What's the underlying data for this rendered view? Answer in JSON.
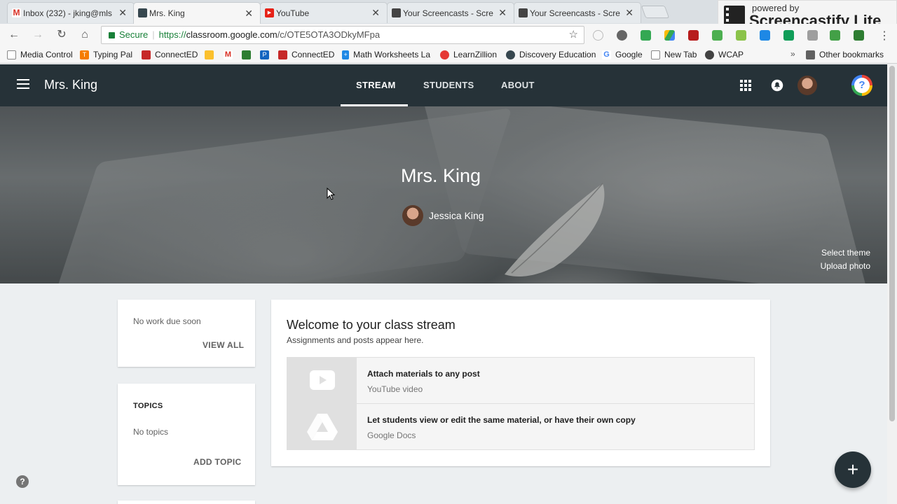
{
  "browser": {
    "tabs": [
      {
        "title": "Inbox (232) - jking@mls",
        "icon": "gmail-icon"
      },
      {
        "title": "Mrs. King",
        "icon": "classroom-icon"
      },
      {
        "title": "YouTube",
        "icon": "youtube-icon"
      },
      {
        "title": "Your Screencasts - Scre",
        "icon": "screencastify-icon"
      },
      {
        "title": "Your Screencasts - Scre",
        "icon": "screencastify-icon"
      }
    ],
    "close_glyph": "✕",
    "address": {
      "secure_label": "Secure",
      "scheme": "https://",
      "host": "classroom.google.com",
      "path": "/c/OTE5OTA3ODkyMFpa"
    },
    "bookmarks": [
      "Media Control",
      "Typing Pal",
      "ConnectED",
      "",
      "",
      "",
      "",
      "ConnectED",
      "Math Worksheets La",
      "LearnZillion",
      "Discovery Education",
      "Google",
      "New Tab",
      "WCAP"
    ],
    "bookmarks_more": "»",
    "other_bookmarks": "Other bookmarks"
  },
  "watermark": {
    "small": "powered by",
    "big": "Screencastify Lite"
  },
  "classroom": {
    "class_name": "Mrs. King",
    "tabs": [
      "STREAM",
      "STUDENTS",
      "ABOUT"
    ],
    "banner": {
      "title": "Mrs. King",
      "teacher": "Jessica King",
      "select_theme": "Select theme",
      "upload_photo": "Upload photo"
    },
    "upcoming": {
      "status": "No work due soon",
      "view_all": "VIEW ALL"
    },
    "topics": {
      "heading": "TOPICS",
      "status": "No topics",
      "add_topic": "ADD TOPIC"
    },
    "welcome": {
      "title": "Welcome to your class stream",
      "subtitle": "Assignments and posts appear here.",
      "features": [
        {
          "title": "Attach materials to any post",
          "subtitle": "YouTube video",
          "icon": "youtube-play-icon"
        },
        {
          "title": "Let students view or edit the same material, or have their own copy",
          "subtitle": "Google Docs",
          "icon": "google-drive-icon"
        }
      ]
    },
    "fab_label": "+",
    "help_label": "?"
  },
  "colors": {
    "appbar": "#263238",
    "page_bg": "#eceff1",
    "secure_green": "#188038"
  }
}
